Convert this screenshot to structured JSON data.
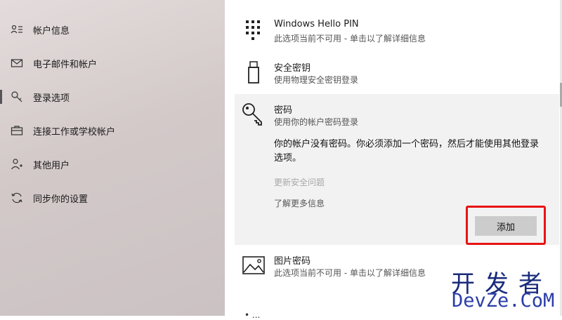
{
  "sidebar": {
    "items": [
      {
        "label": "帐户信息",
        "icon": "account-info-icon"
      },
      {
        "label": "电子邮件和帐户",
        "icon": "mail-icon"
      },
      {
        "label": "登录选项",
        "icon": "key-icon",
        "selected": true
      },
      {
        "label": "连接工作或学校帐户",
        "icon": "briefcase-icon"
      },
      {
        "label": "其他用户",
        "icon": "person-add-icon"
      },
      {
        "label": "同步你的设置",
        "icon": "sync-icon"
      }
    ]
  },
  "options": {
    "pin": {
      "title": "Windows Hello PIN",
      "subtitle": "此选项当前不可用 - 单击以了解详细信息",
      "icon": "keypad-icon"
    },
    "security_key": {
      "title": "安全密钥",
      "subtitle": "使用物理安全密钥登录",
      "icon": "usb-key-icon"
    },
    "password": {
      "title": "密码",
      "subtitle": "使用你的帐户密码登录",
      "icon": "password-key-icon",
      "message": "你的帐户没有密码。你必须添加一个密码，然后才能使用其他登录选项。",
      "link_security_questions": "更新安全问题",
      "link_learn_more": "了解更多信息",
      "add_label": "添加"
    },
    "picture_password": {
      "title": "图片密码",
      "subtitle": "此选项当前不可用 - 单击以了解详细信息",
      "icon": "picture-icon"
    }
  },
  "watermark": {
    "cn": "开发者",
    "en": "DevZe.CoM"
  },
  "cutoff_text": "• ..."
}
